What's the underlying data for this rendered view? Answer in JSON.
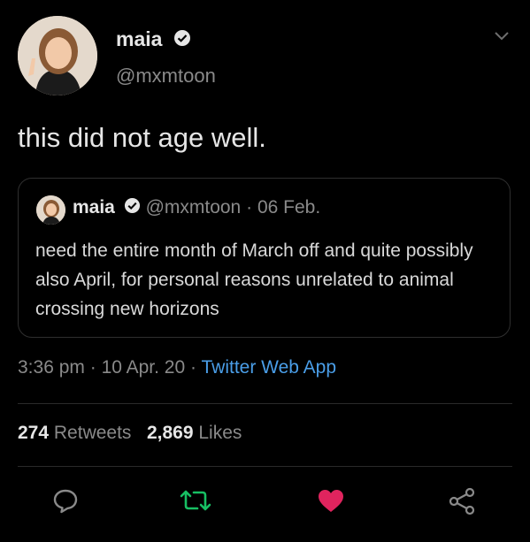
{
  "author": {
    "name": "maia",
    "handle": "@mxmtoon",
    "verified_icon": "verified-badge-icon"
  },
  "tweet": {
    "text": "this did not age well."
  },
  "quoted": {
    "name": "maia",
    "handle": "@mxmtoon",
    "separator": "·",
    "date": "06 Feb.",
    "text": "need the entire month of March off and quite possibly also April, for personal reasons unrelated to animal crossing new horizons"
  },
  "meta": {
    "time": "3:36 pm",
    "separator": "·",
    "date": "10 Apr. 20",
    "source": "Twitter Web App"
  },
  "stats": {
    "retweets_count": "274",
    "retweets_label": "Retweets",
    "likes_count": "2,869",
    "likes_label": "Likes"
  },
  "colors": {
    "link": "#4a9ee8",
    "retweet_active": "#17bf63",
    "like_active": "#e0245e"
  },
  "icons": [
    "reply-icon",
    "retweet-icon",
    "like-icon",
    "share-icon",
    "chevron-down-icon"
  ]
}
